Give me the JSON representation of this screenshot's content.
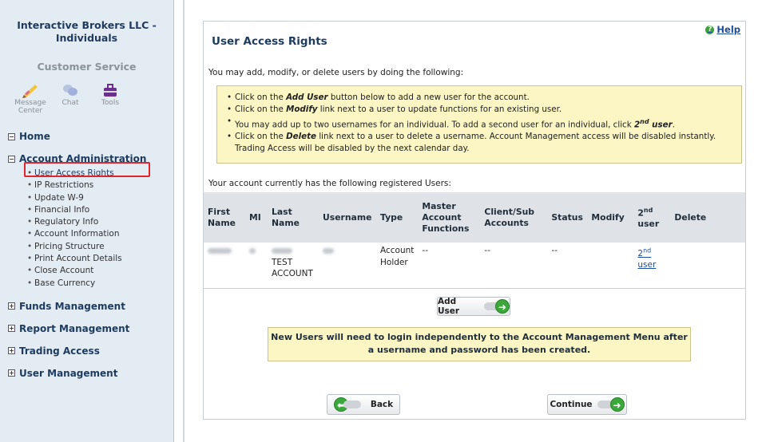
{
  "sidebar": {
    "firm_line1": "Interactive Brokers LLC -",
    "firm_line2": "Individuals",
    "customer_service": "Customer Service",
    "cs_icons": [
      {
        "label": "Message Center",
        "icon": "message-center-icon"
      },
      {
        "label": "Chat",
        "icon": "chat-icon"
      },
      {
        "label": "Tools",
        "icon": "tools-icon"
      }
    ],
    "home": "Home",
    "account_admin": "Account Administration",
    "account_admin_items": [
      "User Access Rights",
      "IP Restrictions",
      "Update W-9",
      "Financial Info",
      "Regulatory Info",
      "Account Information",
      "Pricing Structure",
      "Print Account Details",
      "Close Account",
      "Base Currency"
    ],
    "funds": "Funds Management",
    "report": "Report Management",
    "trading": "Trading Access",
    "user_mgmt": "User Management"
  },
  "page": {
    "help": "Help",
    "title": "User Access Rights",
    "intro": "You may add, modify, or delete users by doing the following:",
    "bullets": {
      "b1_pre": "Click on the ",
      "b1_bold": "Add User",
      "b1_post": " button below to add a new user for the account.",
      "b2_pre": "Click on the ",
      "b2_bold": "Modify",
      "b2_post": " link next to a user to update functions for an existing user.",
      "b3_pre": "You may add up to two usernames for an individual. To add a second user for an individual, click ",
      "b3_bold": "2",
      "b3_sup": "nd",
      "b3_bold2": " user",
      "b3_post": ".",
      "b4_pre": "Click on the ",
      "b4_bold": "Delete",
      "b4_post": " link next to a user to delete a username. Account Management access will be disabled instantly. Trading Access will be disabled by the next calendar day."
    },
    "registered": "Your account currently has the following registered Users:",
    "table": {
      "headers": {
        "first": "First Name",
        "mi": "MI",
        "last": "Last Name",
        "username": "Username",
        "type": "Type",
        "master": "Master Account Functions",
        "client": "Client/Sub Accounts",
        "status": "Status",
        "modify": "Modify",
        "second_base": "2",
        "second_sup": "nd",
        "second_word": "user",
        "delete": "Delete"
      },
      "row": {
        "last_line2": "TEST",
        "last_line3": "ACCOUNT",
        "type": "Account Holder",
        "master": "--",
        "client": "--",
        "status": "--",
        "second_base": "2",
        "second_sup": "nd",
        "second_word": "user"
      }
    },
    "add_user": "Add User",
    "warning": "New Users will need to login independently to the Account Management Menu after a username and password has been created.",
    "back": "Back",
    "continue": "Continue"
  }
}
